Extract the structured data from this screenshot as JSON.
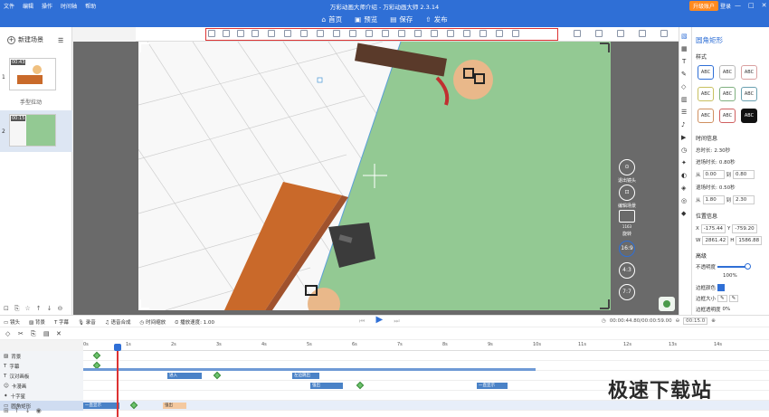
{
  "app": {
    "menus": [
      "文件",
      "编辑",
      "操作",
      "时间轴",
      "帮助"
    ],
    "title": "万彩动画大师介绍 - 万彩动画大师 2.3.14",
    "nav": [
      {
        "label": "首页",
        "icon": "home-icon"
      },
      {
        "label": "预览",
        "icon": "preview-icon"
      },
      {
        "label": "保存",
        "icon": "save-icon"
      },
      {
        "label": "发布",
        "icon": "publish-icon"
      }
    ],
    "upgrade": "升级账户",
    "login": "登录",
    "window_controls": [
      "—",
      "□",
      "✕"
    ]
  },
  "left": {
    "new_scene": "新建场景",
    "scenes": [
      {
        "num": "1",
        "time": "00:43",
        "label": "手型拉动"
      },
      {
        "num": "2",
        "time": "00:15",
        "label": ""
      }
    ]
  },
  "canvas": {
    "right_controls": [
      {
        "label": "退出镜头",
        "icon": "exit-camera-icon"
      },
      {
        "label": "编辑场景",
        "icon": "edit-scene-icon"
      },
      {
        "label": "旋转",
        "icon": "rotate-icon"
      },
      {
        "label": "16:9",
        "icon": ""
      },
      {
        "label": "4:3",
        "icon": ""
      },
      {
        "label": "7:7",
        "icon": ""
      }
    ],
    "bg_color": "#93c993",
    "camera_label": "1163"
  },
  "panel": {
    "title": "圆角矩形",
    "style_head": "样式",
    "abc": "ABC",
    "time_head": "时间信息",
    "total_time_label": "总时长:",
    "total_time": "2.30秒",
    "enter_label": "进场时长:",
    "enter_time": "0.80秒",
    "from1": "0.00",
    "to1": "0.80",
    "exit_label": "退场时长:",
    "exit_time": "0.50秒",
    "from2": "1.80",
    "to2": "2.30",
    "pos_head": "位置信息",
    "x": "-175.44",
    "y": "-759.20",
    "w": "2861.42",
    "h": "1586.88",
    "adv_head": "高级",
    "opacity_label": "不透明度",
    "opacity": "100%",
    "border_color_label": "边框颜色",
    "border_size_label": "边框大小",
    "border_opacity_label": "边框透明度",
    "border_opacity": "0%",
    "from_label": "从",
    "to_label": "到",
    "x_label": "X",
    "y_label": "Y",
    "w_label": "W",
    "h_label": "H"
  },
  "timeline": {
    "tools": [
      "镜头",
      "背景",
      "字幕",
      "录音",
      "语音合成",
      "时间缩放",
      "播放速度: 1.00"
    ],
    "time": "00:00:44.80/00:00:59.00",
    "zoom": "00:15.0",
    "ruler": [
      "0s",
      "1s",
      "2s",
      "3s",
      "4s",
      "5s",
      "6s",
      "7s",
      "8s",
      "9s",
      "10s",
      "11s",
      "12s",
      "13s",
      "14s"
    ],
    "tracks": [
      "背景",
      "字幕",
      "汉对画板",
      "卡漫画",
      "十字星",
      "圆角矩形"
    ],
    "clips": [
      "进入",
      "左边跳出",
      "强出",
      "一直显示",
      "一直显示",
      "强出"
    ]
  },
  "watermark": "极速下载站"
}
